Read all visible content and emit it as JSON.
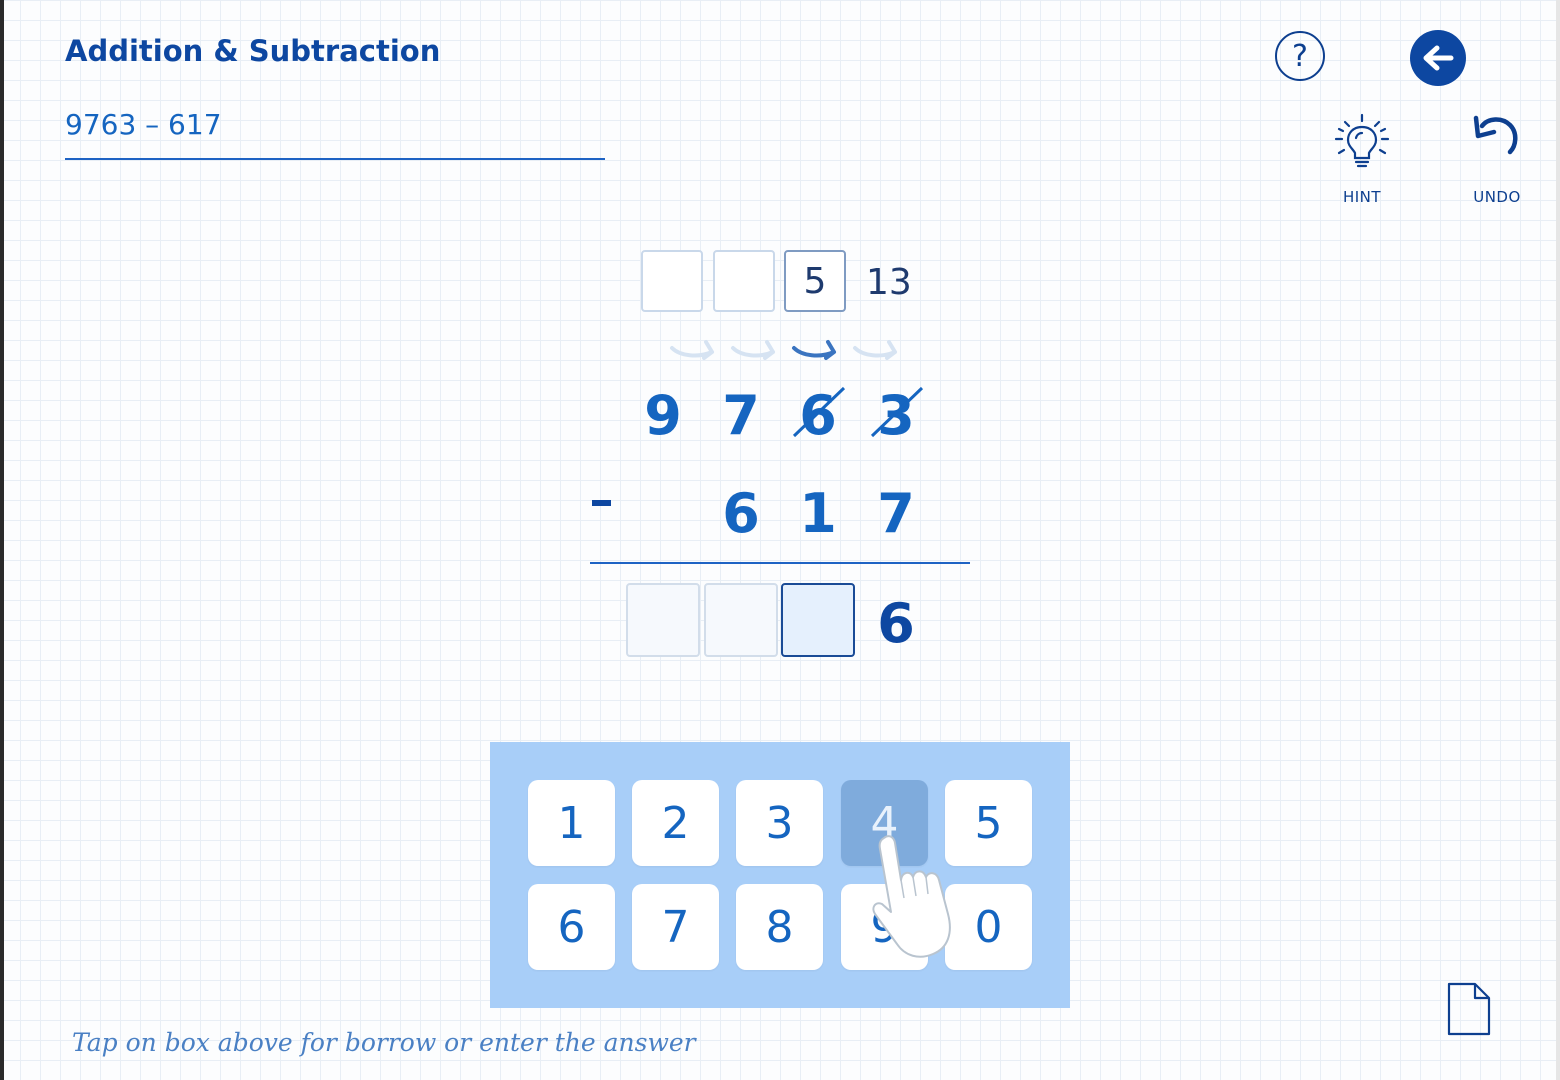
{
  "header": {
    "title": "Addition & Subtraction",
    "problem": "9763 – 617"
  },
  "toolbar": {
    "help_icon": "question-mark-icon",
    "back_icon": "arrow-left-icon",
    "hint_label": "HINT",
    "undo_label": "UNDO"
  },
  "worksheet": {
    "borrow_boxes": [
      "",
      "",
      "5"
    ],
    "borrow_value": "13",
    "minuend": [
      "9",
      "7",
      "6",
      "3"
    ],
    "struck_digits": [
      2,
      3
    ],
    "operator": "-",
    "subtrahend": [
      "6",
      "1",
      "7"
    ],
    "answer_boxes": [
      "",
      "",
      ""
    ],
    "answer_digit": "6"
  },
  "keypad": {
    "keys": [
      "1",
      "2",
      "3",
      "4",
      "5",
      "6",
      "7",
      "8",
      "9",
      "0"
    ],
    "pressed": "4"
  },
  "footer": {
    "instruction": "Tap on box above for borrow or enter the answer"
  },
  "colors": {
    "primary": "#0d47a1",
    "digit": "#1565c0",
    "keypad_bg": "#a8cef8",
    "key_pressed": "#7fabdc"
  }
}
